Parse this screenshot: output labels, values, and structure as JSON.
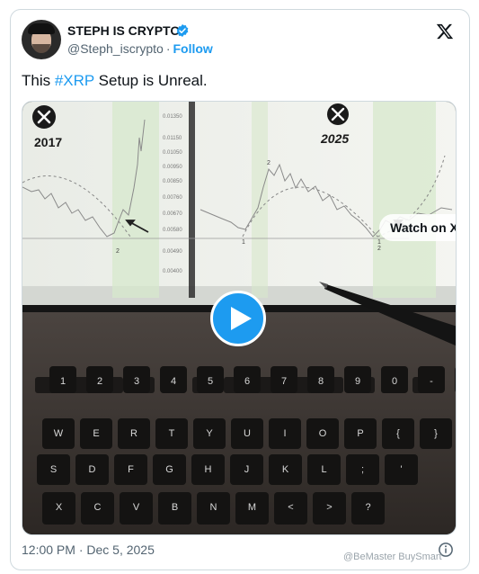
{
  "author": {
    "name": "STEPH IS CRYPTO",
    "handle": "@Steph_iscrypto",
    "separator": "·",
    "follow_label": "Follow"
  },
  "post": {
    "text_before": "This ",
    "hashtag": "#XRP",
    "text_after": " Setup is Unreal.",
    "timestamp": "12:00 PM · Dec 5, 2025"
  },
  "media": {
    "watch_label": "Watch on X",
    "overlay": {
      "left_year": "2017",
      "right_year": "2025"
    },
    "chart_ticks": [
      "0.01350",
      "0.01150",
      "0.01050",
      "0.00950",
      "0.00850",
      "0.00760",
      "0.00670",
      "0.00580",
      "0.00490",
      "0.00400"
    ],
    "chart_markers": [
      "2",
      "2",
      "1",
      "1",
      "2"
    ],
    "keyboard": {
      "row1": [
        "1",
        "2",
        "3",
        "4",
        "5",
        "6",
        "7",
        "8",
        "9",
        "0",
        "-",
        "="
      ],
      "row2": [
        "W",
        "E",
        "R",
        "T",
        "Y",
        "U",
        "I",
        "O",
        "P",
        "{",
        "}"
      ],
      "row3": [
        "S",
        "D",
        "F",
        "G",
        "H",
        "J",
        "K",
        "L",
        ";",
        "'"
      ],
      "row4": [
        "X",
        "C",
        "V",
        "B",
        "N",
        "M",
        "<",
        ">",
        "?"
      ]
    }
  },
  "watermark": "@BeMaster BuySmart",
  "colors": {
    "accent": "#1d9bf0",
    "text": "#0f1419",
    "muted": "#536471",
    "border": "#cfd9de"
  },
  "icons": [
    "verified-badge-icon",
    "x-logo-icon",
    "play-icon",
    "info-icon"
  ]
}
